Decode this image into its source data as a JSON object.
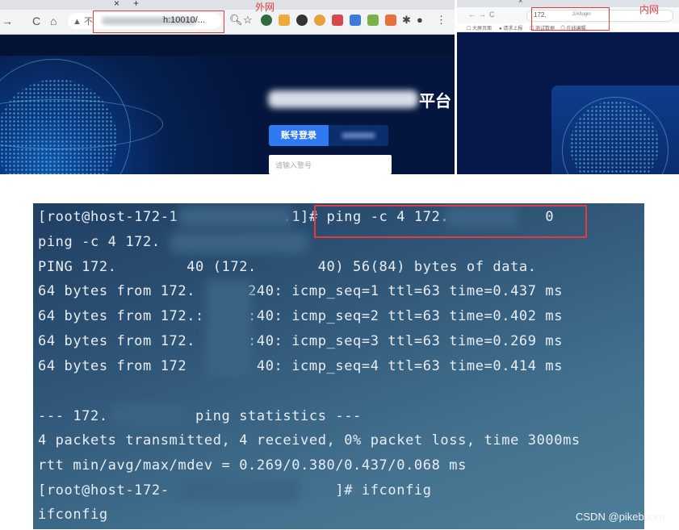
{
  "annotations": {
    "external_label": "外网",
    "internal_label": "内网",
    "highlight_color": "#e53b3b"
  },
  "left_browser": {
    "tab_close": "×",
    "tab_new": "+",
    "nav": {
      "forward": "→",
      "reload": "C",
      "home": "⌂"
    },
    "security_text": "▲ 不",
    "url_visible": "h:10010/...",
    "toolbar_icons": [
      "search-icon",
      "star-icon",
      "extension-icons",
      "puzzle-icon",
      "profile-icon",
      "menu-icon"
    ],
    "page": {
      "title_suffix": "平台",
      "login_tab_active": "账号登录",
      "input_placeholder": "请输入警号"
    }
  },
  "right_browser": {
    "nav": {
      "back": "←",
      "forward": "→",
      "reload": "C"
    },
    "tab_close": "×",
    "url_prefix": "172.",
    "url_suffix": "2/#/login",
    "bookmarks": [
      "☐ 大屏页面",
      "● 请求上报",
      "☐ 测试数据",
      "◎ 在线编辑"
    ]
  },
  "terminal": {
    "lines": [
      "[root@host-172-1            .1]# ping -c 4 172.           0",
      "ping -c 4 172.",
      "PING 172.        40 (172.       40) 56(84) bytes of data.",
      "64 bytes from 172.      240: icmp_seq=1 ttl=63 time=0.437 ms",
      "64 bytes from 172.:     :40: icmp_seq=2 ttl=63 time=0.402 ms",
      "64 bytes from 172.      :40: icmp_seq=3 ttl=63 time=0.269 ms",
      "64 bytes from 172        40: icmp_seq=4 ttl=63 time=0.414 ms",
      "",
      "--- 172.          ping statistics ---",
      "4 packets transmitted, 4 received, 0% packet loss, time 3000ms",
      "rtt min/avg/max/mdev = 0.269/0.380/0.437/0.068 ms",
      "[root@host-172-                   ]# ifconfig",
      "ifconfig"
    ]
  },
  "watermark": "CSDN @pikeboom"
}
